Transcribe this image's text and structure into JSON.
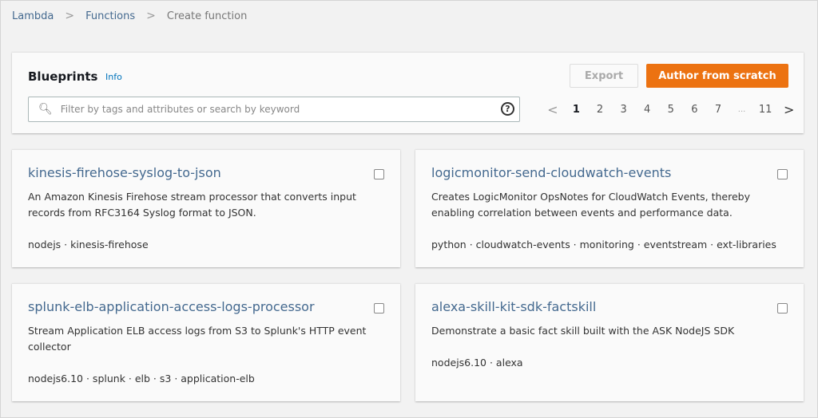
{
  "breadcrumb": [
    "Lambda",
    "Functions",
    "Create function"
  ],
  "header": {
    "title": "Blueprints",
    "info": "Info",
    "export": "Export",
    "author": "Author from scratch",
    "search_placeholder": "Filter by tags and attributes or search by keyword",
    "help": "?"
  },
  "pager": {
    "prev": "<",
    "pages": [
      "1",
      "2",
      "3",
      "4",
      "5",
      "6",
      "7",
      "...",
      "11"
    ],
    "current": "1",
    "next": ">"
  },
  "cards": [
    {
      "name": "kinesis-firehose-syslog-to-json",
      "desc": "An Amazon Kinesis Firehose stream processor that converts input records from RFC3164 Syslog format to JSON.",
      "tags": "nodejs · kinesis-firehose"
    },
    {
      "name": "logicmonitor-send-cloudwatch-events",
      "desc": "Creates LogicMonitor OpsNotes for CloudWatch Events, thereby enabling correlation between events and performance data.",
      "tags": "python · cloudwatch-events · monitoring · eventstream · ext-libraries"
    },
    {
      "name": "splunk-elb-application-access-logs-processor",
      "desc": "Stream Application ELB access logs from S3 to Splunk's HTTP event collector",
      "tags": "nodejs6.10 · splunk · elb · s3 · application-elb"
    },
    {
      "name": "alexa-skill-kit-sdk-factskill",
      "desc": "Demonstrate a basic fact skill built with the ASK NodeJS SDK",
      "tags": "nodejs6.10 · alexa"
    }
  ]
}
